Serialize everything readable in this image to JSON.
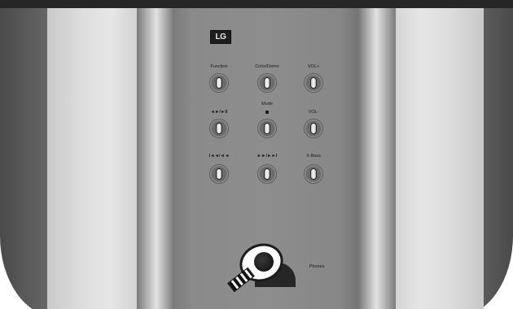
{
  "logo_text": "LG",
  "buttons": [
    {
      "label": "Function"
    },
    {
      "label": "Color/Demo"
    },
    {
      "label": "VOL+"
    },
    {
      "label": "◄►/►II"
    },
    {
      "label": "Mode"
    },
    {
      "label": "VOL-"
    },
    {
      "label": "I◄◄/◄◄"
    },
    {
      "label": "►►/►►I"
    },
    {
      "label": "X-Bass"
    }
  ],
  "phono_label": "Phones"
}
